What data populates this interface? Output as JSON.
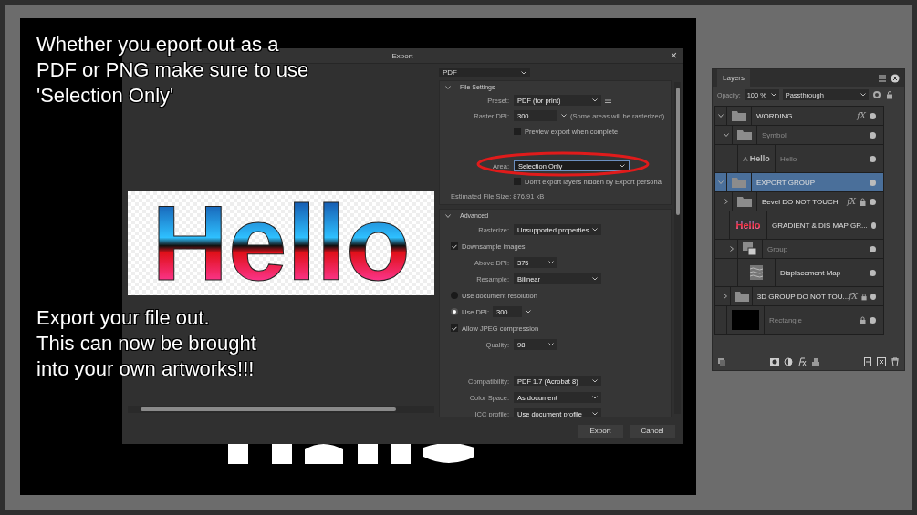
{
  "captions": [
    {
      "lines": [
        "Whether you eport out as a",
        "PDF or PNG make sure to use",
        "'Selection Only'"
      ]
    },
    {
      "lines": [
        "Export your file out.",
        "This can now be brought",
        "into your own artworks!!!"
      ]
    }
  ],
  "dialog": {
    "title": "Export",
    "close": "×",
    "preview_text": "Hello",
    "format": "PDF",
    "sections": [
      {
        "title": "File Settings",
        "expanded": true,
        "footer": "Estimated File Size: 876.91 kB",
        "rows": [
          {
            "kind": "select",
            "label": "Preset:",
            "value": "PDF (for print)",
            "menu": true
          },
          {
            "kind": "number",
            "label": "Raster DPI:",
            "value": "300",
            "note": "(Some areas will be rasterized)"
          },
          {
            "kind": "checkbox",
            "label": "Preview export when complete",
            "checked": false
          },
          {
            "kind": "spacer"
          },
          {
            "kind": "select",
            "label": "Area:",
            "value": "Selection Only",
            "circled": true
          },
          {
            "kind": "checkbox",
            "label": "Don't export layers hidden by Export persona",
            "checked": false
          }
        ]
      },
      {
        "title": "Advanced",
        "expanded": true,
        "rows": [
          {
            "kind": "select",
            "label": "Rasterize:",
            "value": "Unsupported properties"
          },
          {
            "kind": "checkbox",
            "label": "Downsample images",
            "checked": true
          },
          {
            "kind": "small",
            "label": "Above DPI:",
            "value": "375"
          },
          {
            "kind": "select",
            "label": "Resample:",
            "value": "Bilinear"
          },
          {
            "kind": "radio",
            "label": "Use document resolution",
            "selected": false
          },
          {
            "kind": "radio",
            "label": "Use DPI:",
            "selected": true,
            "value": "300"
          },
          {
            "kind": "checkbox",
            "label": "Allow JPEG compression",
            "checked": true
          },
          {
            "kind": "small",
            "label": "Quality:",
            "value": "98"
          },
          {
            "kind": "spacer"
          },
          {
            "kind": "select",
            "label": "Compatibility:",
            "value": "PDF 1.7 (Acrobat 8)"
          },
          {
            "kind": "select",
            "label": "Color Space:",
            "value": "As document"
          },
          {
            "kind": "select",
            "label": "ICC profile:",
            "value": "Use document profile"
          }
        ]
      }
    ],
    "buttons": [
      "Export",
      "Cancel"
    ]
  },
  "layers": {
    "title": "Layers",
    "opacity_label": "Opacity:",
    "opacity": "100 %",
    "blend": "Passthrough",
    "items": [
      {
        "name": "WORDING",
        "kind": "folder",
        "expanded": true,
        "effects": "fX",
        "locked": false,
        "dimmed": false,
        "selected": false,
        "children": [
          {
            "name": "Symbol",
            "kind": "folder",
            "expanded": true,
            "locked": false,
            "dimmed": true,
            "selected": false,
            "children": [
              {
                "name": "Hello",
                "kind": "text",
                "type_glyph": "A",
                "thumb_text": "Hello",
                "locked": false,
                "dimmed": true,
                "selected": false
              }
            ]
          }
        ]
      },
      {
        "name": "EXPORT GROUP",
        "kind": "folder",
        "expanded": true,
        "locked": false,
        "dimmed": false,
        "selected": true,
        "children": [
          {
            "name": "Bevel DO NOT TOUCH",
            "kind": "folder",
            "expanded": false,
            "effects": "fX",
            "locked": true,
            "dimmed": false,
            "selected": false
          },
          {
            "name": "GRADIENT & DIS MAP GR...",
            "kind": "gradient",
            "thumb_text": "Hello",
            "locked": false,
            "dimmed": false,
            "selected": false,
            "children": [
              {
                "name": "Group",
                "kind": "group",
                "expanded": false,
                "locked": false,
                "dimmed": true,
                "selected": false
              },
              {
                "name": "Displacement Map",
                "kind": "pattern",
                "locked": false,
                "dimmed": false,
                "selected": false
              }
            ]
          },
          {
            "name": "3D GROUP DO NOT TOU...",
            "kind": "folder",
            "expanded": false,
            "effects": "fX",
            "locked": true,
            "dimmed": false,
            "selected": false
          }
        ]
      },
      {
        "name": "Rectangle",
        "kind": "fill",
        "locked": true,
        "dimmed": true,
        "selected": false
      }
    ]
  }
}
